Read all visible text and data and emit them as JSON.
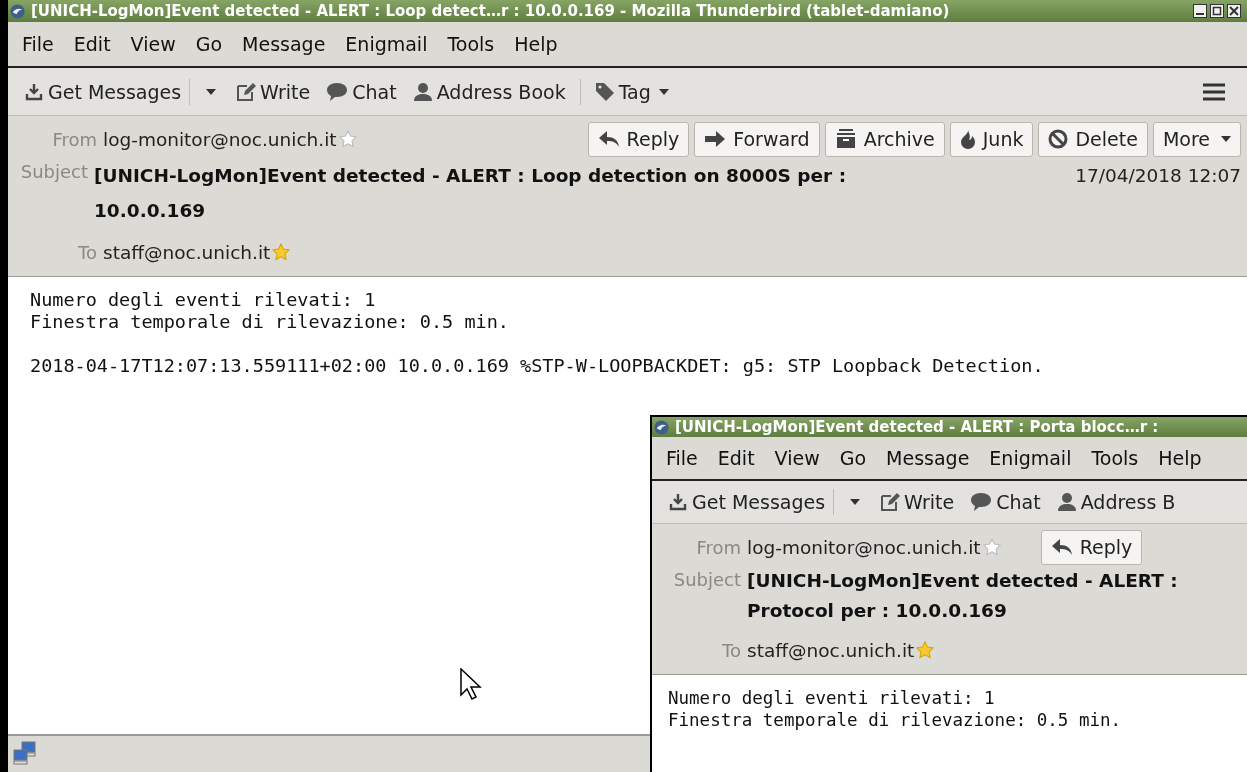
{
  "windows": [
    {
      "title": "[UNICH-LogMon]Event detected - ALERT : Loop detect…r : 10.0.0.169 - Mozilla Thunderbird (tablet-damiano)",
      "window_controls": true,
      "menu": [
        {
          "label": "File"
        },
        {
          "label": "Edit"
        },
        {
          "label": "View"
        },
        {
          "label": "Go"
        },
        {
          "label": "Message"
        },
        {
          "label": "Enigmail"
        },
        {
          "label": "Tools"
        },
        {
          "label": "Help"
        }
      ],
      "toolbar": [
        {
          "kind": "get",
          "label": "Get Messages"
        },
        {
          "kind": "write",
          "label": "Write"
        },
        {
          "kind": "chat",
          "label": "Chat"
        },
        {
          "kind": "addressbook",
          "label": "Address Book"
        },
        {
          "kind": "tag",
          "label": "Tag"
        },
        {
          "kind": "appmenu"
        }
      ],
      "header_buttons": [
        {
          "kind": "reply",
          "label": "Reply"
        },
        {
          "kind": "forward",
          "label": "Forward"
        },
        {
          "kind": "archive",
          "label": "Archive"
        },
        {
          "kind": "junk",
          "label": "Junk"
        },
        {
          "kind": "delete",
          "label": "Delete"
        },
        {
          "kind": "more",
          "label": "More"
        }
      ],
      "from": {
        "label": "From",
        "address": "log-monitor@noc.unich.it",
        "in_address_book": false
      },
      "subject": {
        "label": "Subject",
        "lines": [
          "[UNICH-LogMon]Event detected - ALERT : Loop detection on 8000S per :",
          "10.0.0.169"
        ]
      },
      "date": "17/04/2018 12:07",
      "to": {
        "label": "To",
        "address": "staff@noc.unich.it",
        "in_address_book": true
      },
      "body": [
        [
          "Numero degli eventi rilevati: 1",
          "Finestra temporale di rilevazione: 0.5 min."
        ],
        [
          "2018-04-17T12:07:13.559111+02:00 10.0.0.169 %STP-W-LOOPBACKDET: g5: STP Loopback Detection."
        ]
      ],
      "status_bar": {
        "kind": "online"
      }
    },
    {
      "title": "[UNICH-LogMon]Event detected - ALERT : Porta blocc…r :",
      "window_controls": false,
      "menu": [
        {
          "label": "File"
        },
        {
          "label": "Edit"
        },
        {
          "label": "View"
        },
        {
          "label": "Go"
        },
        {
          "label": "Message"
        },
        {
          "label": "Enigmail"
        },
        {
          "label": "Tools"
        },
        {
          "label": "Help"
        }
      ],
      "toolbar": [
        {
          "kind": "get",
          "label": "Get Messages"
        },
        {
          "kind": "write",
          "label": "Write"
        },
        {
          "kind": "chat",
          "label": "Chat"
        },
        {
          "kind": "addressbook",
          "label": "Address B"
        }
      ],
      "header_buttons": [
        {
          "kind": "reply",
          "label": "Reply"
        }
      ],
      "from": {
        "label": "From",
        "address": "log-monitor@noc.unich.it",
        "in_address_book": false
      },
      "subject": {
        "label": "Subject",
        "lines": [
          "[UNICH-LogMon]Event detected - ALERT :",
          "Protocol per : 10.0.0.169"
        ]
      },
      "to": {
        "label": "To",
        "address": "staff@noc.unich.it",
        "in_address_book": true
      },
      "body": [
        [
          "Numero degli eventi rilevati: 1",
          "Finestra temporale di rilevazione: 0.5 min."
        ]
      ]
    }
  ]
}
